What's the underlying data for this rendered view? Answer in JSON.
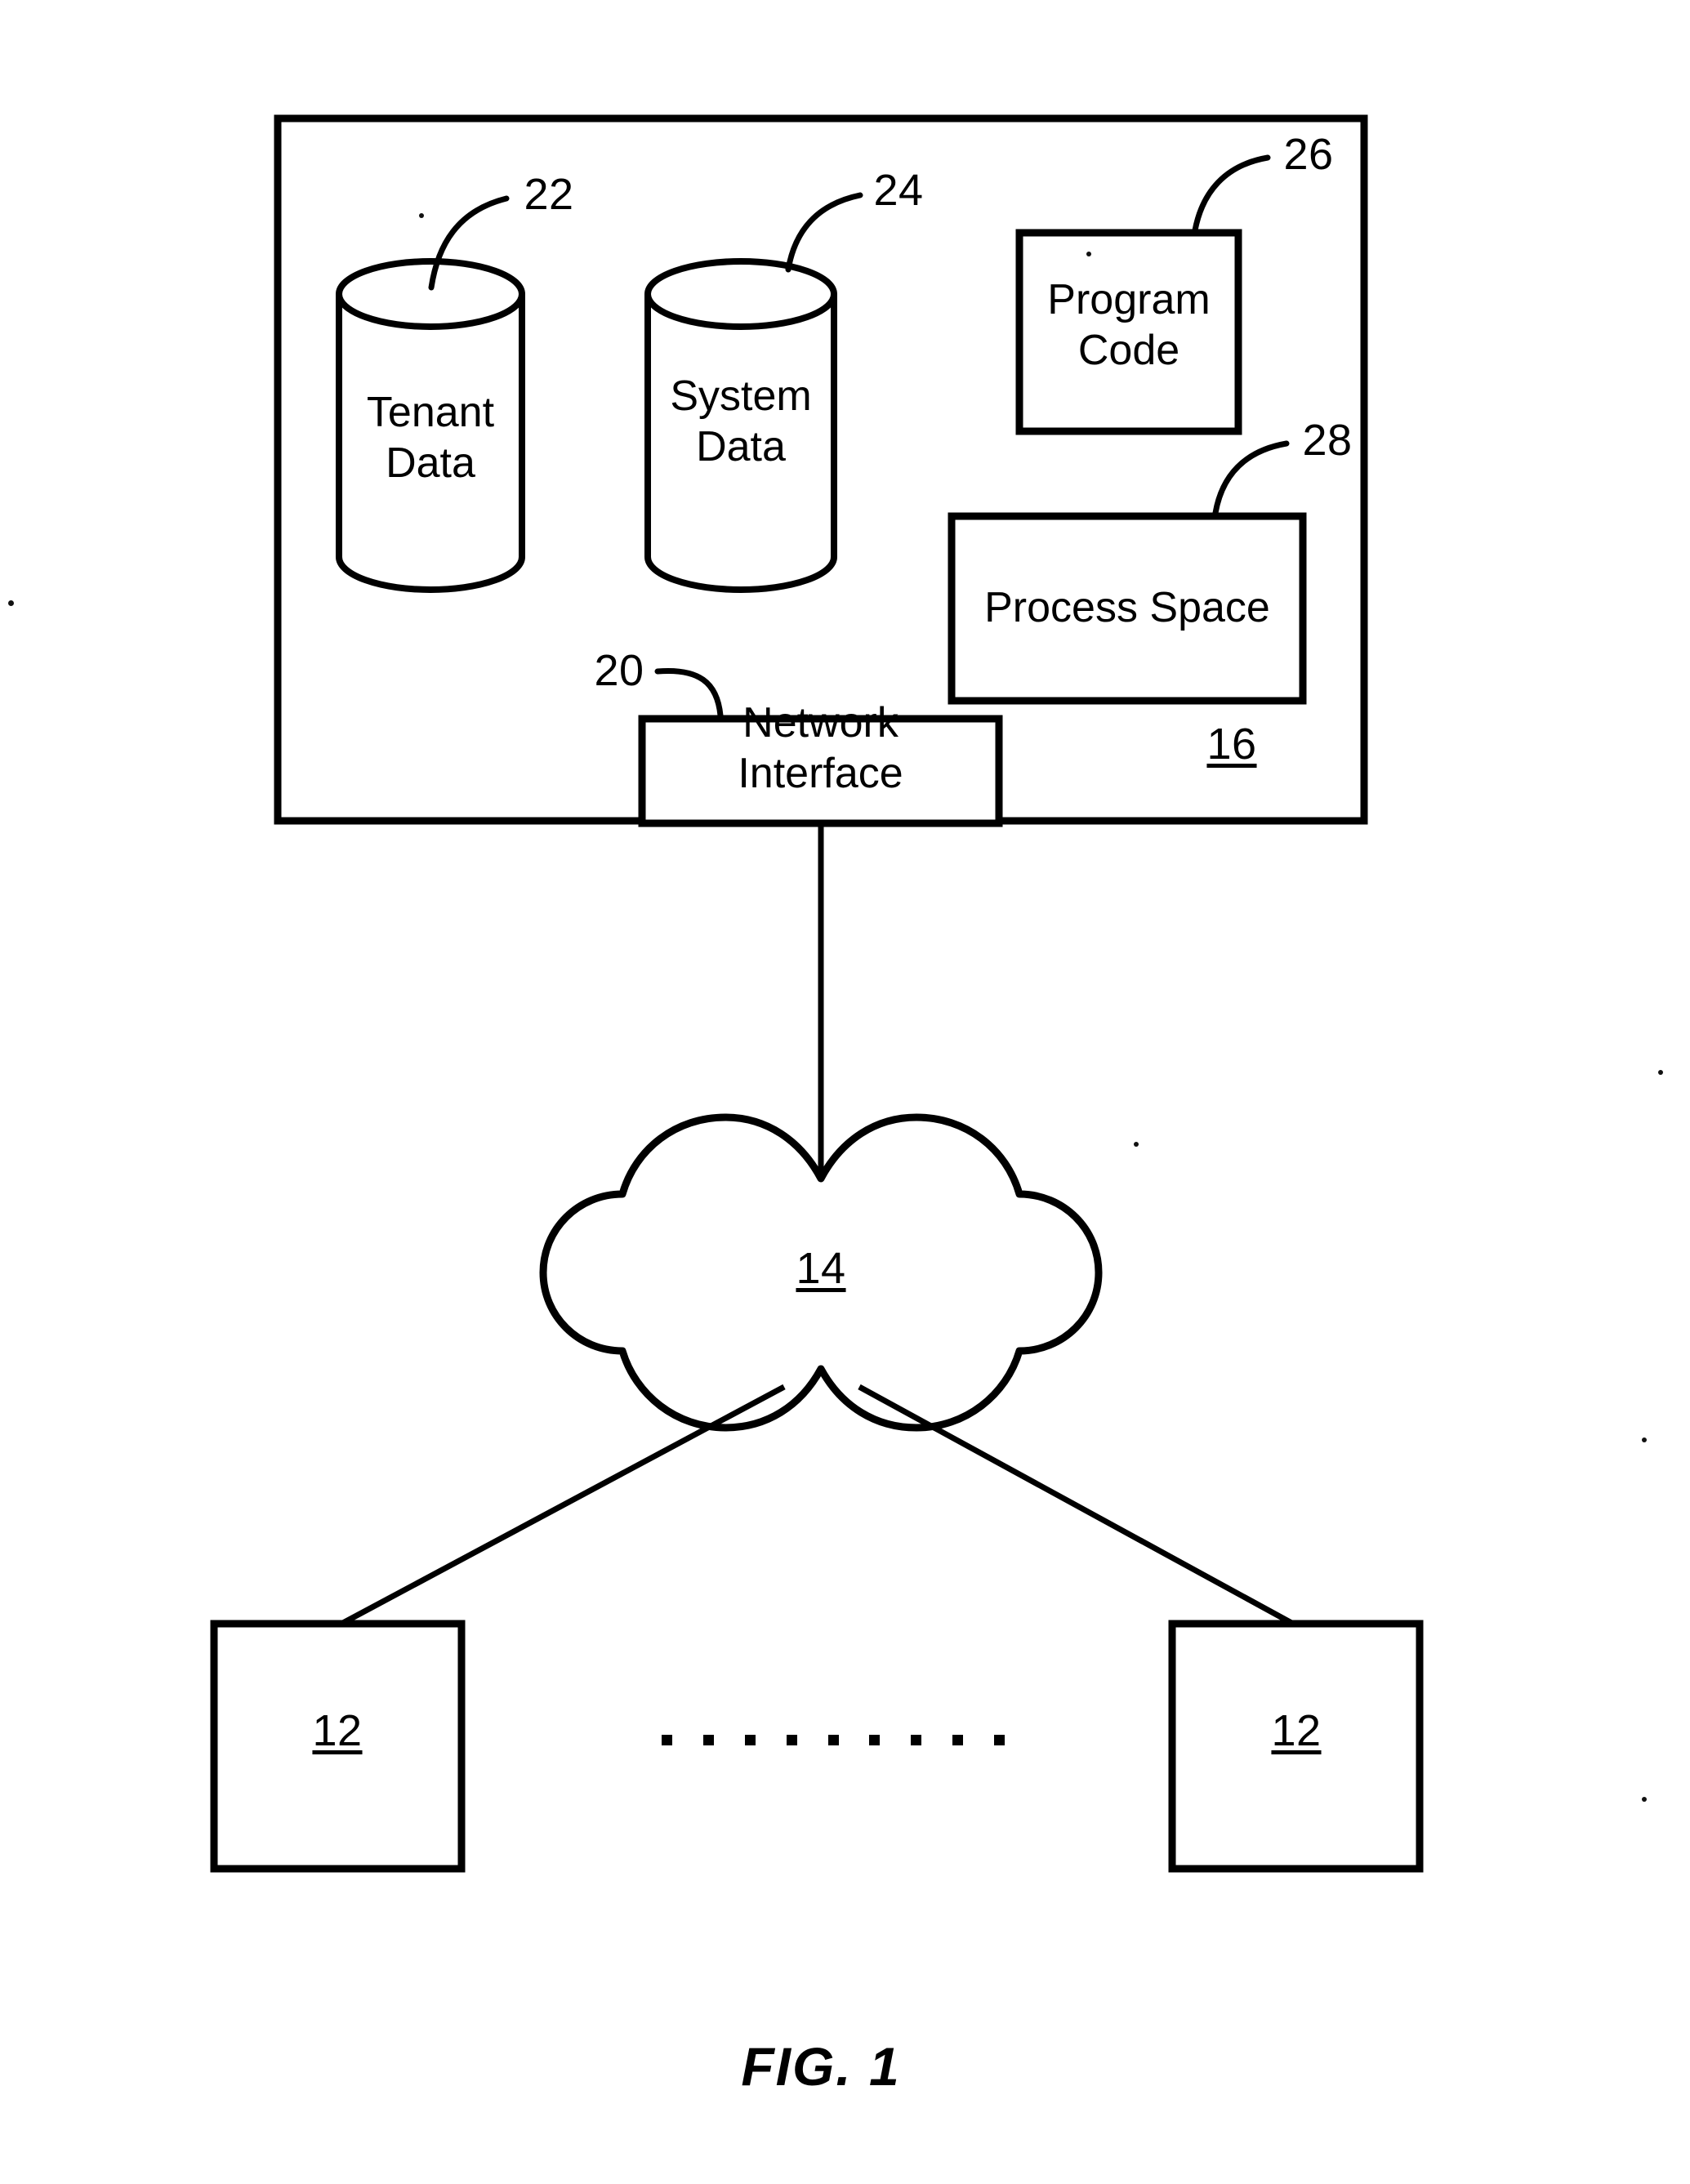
{
  "figure": {
    "caption": "FIG. 1",
    "type": "patent-diagram"
  },
  "system_box": {
    "ref": "16"
  },
  "databases": [
    {
      "id": "tenant-data",
      "line1": "Tenant",
      "line2": "Data",
      "ref": "22"
    },
    {
      "id": "system-data",
      "line1": "System",
      "line2": "Data",
      "ref": "24"
    }
  ],
  "boxes": [
    {
      "id": "program-code",
      "line1": "Program",
      "line2": "Code",
      "ref": "26"
    },
    {
      "id": "process-space",
      "line1": "Process Space",
      "line2": "",
      "ref": "28"
    },
    {
      "id": "network-interface",
      "line1": "Network",
      "line2": "Interface",
      "ref": "20"
    }
  ],
  "cloud": {
    "ref": "14"
  },
  "user_systems": [
    {
      "id": "user-system-left",
      "ref": "12"
    },
    {
      "id": "user-system-right",
      "ref": "12"
    }
  ],
  "ellipsis": {
    "dots": "· · · · · · · · ·",
    "count": 9
  },
  "colors": {
    "line": "#000000",
    "background": "#ffffff"
  }
}
